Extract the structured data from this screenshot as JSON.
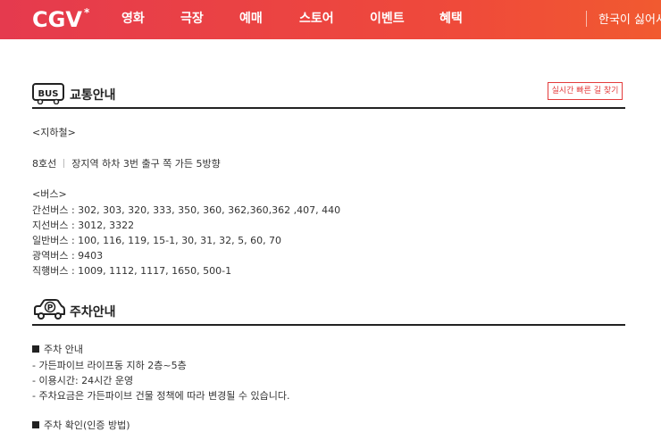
{
  "header": {
    "logo_text": "CGV",
    "nav": [
      "영화",
      "극장",
      "예매",
      "스토어",
      "이벤트",
      "혜택"
    ],
    "right_text": "한국이 싫어서"
  },
  "transport": {
    "title": "교통안내",
    "route_button": "실시간 빠른 길 찾기",
    "subway_heading": "<지하철>",
    "subway_line": "8호선",
    "subway_desc": "장지역 하차 3번 출구 쪽 가든 5방향",
    "bus_heading": "<버스>",
    "bus_lines": [
      "간선버스 : 302, 303, 320, 333, 350, 360, 362,360,362 ,407, 440",
      "지선버스 : 3012, 3322",
      "일반버스 : 100, 116, 119, 15-1, 30, 31, 32, 5, 60, 70",
      "광역버스 : 9403",
      "직행버스 : 1009, 1112, 1117, 1650, 500-1"
    ]
  },
  "parking": {
    "title": "주차안내",
    "info_heading": "주차 안내",
    "info_lines": [
      "- 가든파이브 라이프동 지하 2층~5층",
      "- 이용시간: 24시간 운영",
      "- 주차요금은 가든파이브 건물 정책에 따라 변경될 수 있습니다."
    ],
    "confirm_heading": "주차 확인(인증 방법)"
  },
  "colors": {
    "brand": "#e53a4e",
    "accent_red": "#e33b3b"
  }
}
